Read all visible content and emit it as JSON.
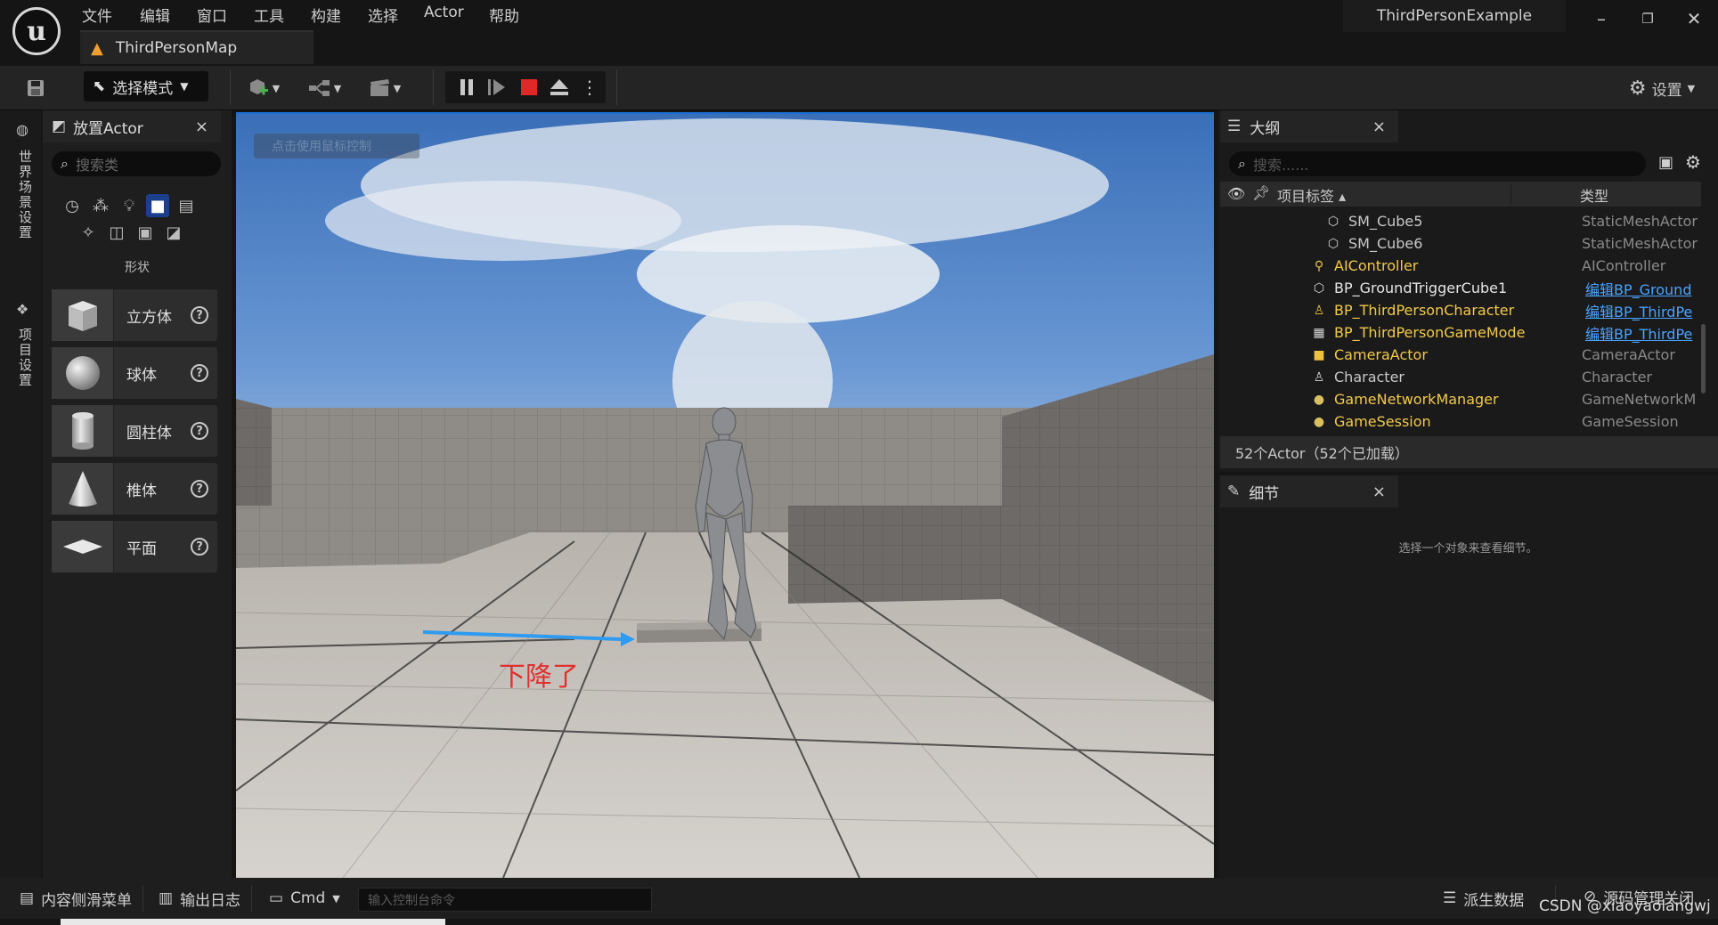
{
  "app": {
    "project_name": "ThirdPersonExample",
    "map_tab": "ThirdPersonMap"
  },
  "menu": [
    "文件",
    "编辑",
    "窗口",
    "工具",
    "构建",
    "选择",
    "Actor",
    "帮助"
  ],
  "toolbar": {
    "mode_label": "选择模式",
    "settings_label": "设置"
  },
  "left_rail": {
    "world_settings": "世界场景设置",
    "project_settings": "项目设置"
  },
  "place_actor": {
    "title": "放置Actor",
    "search_placeholder": "搜索类",
    "category_label": "形状",
    "shapes": [
      {
        "label": "立方体"
      },
      {
        "label": "球体"
      },
      {
        "label": "圆柱体"
      },
      {
        "label": "椎体"
      },
      {
        "label": "平面"
      }
    ]
  },
  "viewport": {
    "hint": "点击使用鼠标控制",
    "annotation": "下降了",
    "annotation_color": "#e03030",
    "arrow_color": "#2f9bf0"
  },
  "outliner": {
    "title": "大纲",
    "search_placeholder": "搜索......",
    "col_label": "项目标签",
    "col_type": "类型",
    "rows": [
      {
        "name": "SM_Cube5",
        "type": "StaticMeshActor",
        "icon": "mesh-icon"
      },
      {
        "name": "SM_Cube6",
        "type": "StaticMeshActor",
        "icon": "mesh-icon"
      },
      {
        "name": "AIController",
        "type": "AIController",
        "icon": "controller-icon"
      },
      {
        "name": "BP_GroundTriggerCube1",
        "type": "编辑BP_Ground",
        "icon": "mesh-icon"
      },
      {
        "name": "BP_ThirdPersonCharacter",
        "type": "编辑BP_ThirdPe",
        "icon": "character-icon"
      },
      {
        "name": "BP_ThirdPersonGameMode",
        "type": "编辑BP_ThirdPe",
        "icon": "gamemode-icon"
      },
      {
        "name": "CameraActor",
        "type": "CameraActor",
        "icon": "camera-icon"
      },
      {
        "name": "Character",
        "type": "Character",
        "icon": "character-icon"
      },
      {
        "name": "GameNetworkManager",
        "type": "GameNetworkM",
        "icon": "info-icon"
      },
      {
        "name": "GameSession",
        "type": "GameSession",
        "icon": "info-icon"
      }
    ],
    "actor_count": "52个Actor（52个已加载）"
  },
  "details": {
    "title": "细节",
    "empty_text": "选择一个对象来查看细节。"
  },
  "bottom": {
    "content_drawer": "内容侧滑菜单",
    "output_log": "输出日志",
    "cmd": "Cmd",
    "console_placeholder": "输入控制台命令",
    "derived_data": "派生数据",
    "source_control": "源码管理关闭",
    "watermark": "CSDN @xiaoyaolangwj"
  }
}
